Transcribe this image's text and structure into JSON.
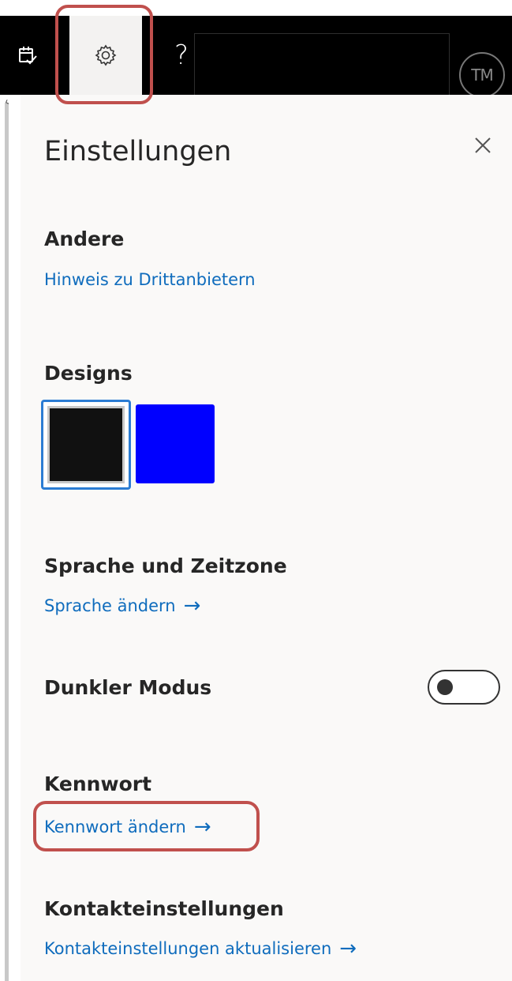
{
  "topbar": {
    "help_label": "?",
    "avatar_initials": "TM"
  },
  "panel": {
    "title": "Einstellungen",
    "close_label": "×"
  },
  "sections": {
    "other": {
      "heading": "Andere",
      "link": "Hinweis zu Drittanbietern"
    },
    "designs": {
      "heading": "Designs",
      "swatches": [
        {
          "name": "dark",
          "color": "#111111",
          "selected": true
        },
        {
          "name": "blue",
          "color": "#0000ff",
          "selected": false
        }
      ]
    },
    "language": {
      "heading": "Sprache und Zeitzone",
      "link": "Sprache ändern",
      "arrow": "→"
    },
    "dark_mode": {
      "heading": "Dunkler Modus",
      "enabled": false
    },
    "password": {
      "heading": "Kennwort",
      "link": "Kennwort ändern",
      "arrow": "→"
    },
    "contacts": {
      "heading": "Kontakteinstellungen",
      "link": "Kontakteinstellungen aktualisieren",
      "arrow": "→"
    }
  },
  "colors": {
    "link": "#0f6cbd",
    "highlight": "#c0504d",
    "topbar": "#000000",
    "panel_bg": "#faf9f8"
  }
}
